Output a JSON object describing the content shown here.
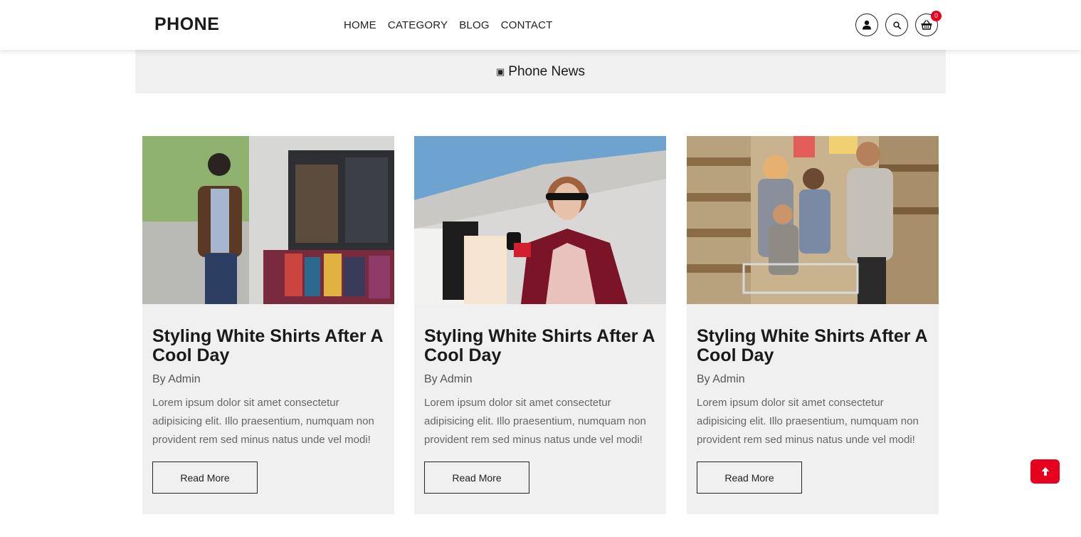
{
  "brand": {
    "logo": "PHONE"
  },
  "nav": {
    "items": [
      "HOME",
      "CATEGORY",
      "BLOG",
      "CONTACT"
    ]
  },
  "header": {
    "cart_count": "0"
  },
  "page": {
    "title": "Phone News",
    "title_glyph": "▣"
  },
  "posts": [
    {
      "image": "man-browsing-clothing-rack",
      "title": "Styling White Shirts After A Cool Day",
      "author": "By Admin",
      "excerpt": "Lorem ipsum dolor sit amet consectetur adipisicing elit. Illo praesentium, numquam non provident rem sed minus natus unde vel modi!",
      "button": "Read More"
    },
    {
      "image": "woman-with-shopping-bags",
      "title": "Styling White Shirts After A Cool Day",
      "author": "By Admin",
      "excerpt": "Lorem ipsum dolor sit amet consectetur adipisicing elit. Illo praesentium, numquam non provident rem sed minus natus unde vel modi!",
      "button": "Read More"
    },
    {
      "image": "family-in-supermarket",
      "title": "Styling White Shirts After A Cool Day",
      "author": "By Admin",
      "excerpt": "Lorem ipsum dolor sit amet consectetur adipisicing elit. Illo praesentium, numquam non provident rem sed minus natus unde vel modi!",
      "button": "Read More"
    }
  ],
  "colors": {
    "accent": "#e8001f",
    "card_bg": "#f0f0f0",
    "text": "#1a1a1a"
  },
  "icons": [
    "user-icon",
    "search-icon",
    "basket-icon",
    "arrow-up-icon"
  ]
}
